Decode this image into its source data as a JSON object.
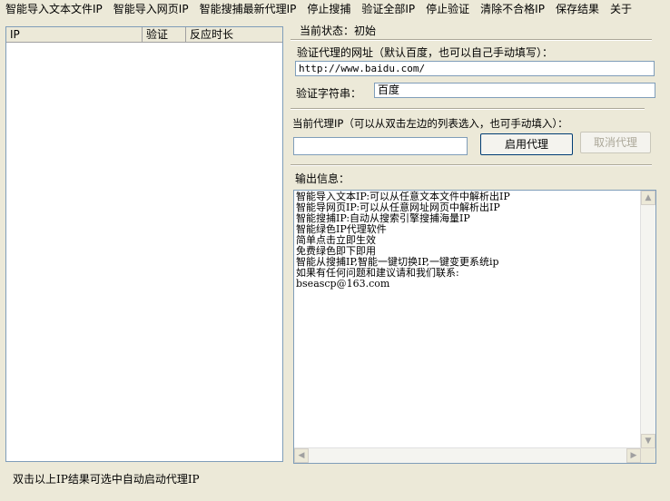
{
  "menu": {
    "items": [
      "智能导入文本文件IP",
      "智能导入网页IP",
      "智能搜捕最新代理IP",
      "停止搜捕",
      "验证全部IP",
      "停止验证",
      "清除不合格IP",
      "保存结果",
      "关于"
    ]
  },
  "list": {
    "columns": [
      "IP",
      "验证",
      "反应时长"
    ]
  },
  "status_panel": {
    "current_status": "当前状态：初始",
    "verify_url_label": "验证代理的网址（默认百度，也可以自己手动填写）：",
    "verify_url_value": "http://www.baidu.com/",
    "verify_string_label": "验证字符串：",
    "verify_string_value": "百度"
  },
  "proxy_panel": {
    "label": "当前代理IP（可以从双击左边的列表选入，也可手动填入）：",
    "proxy_value": "",
    "enable_button": "启用代理",
    "cancel_button": "取消代理"
  },
  "output": {
    "label": "输出信息：",
    "lines": [
      "智能导入文本IP:可以从任意文本文件中解析出IP",
      "智能导网页IP:可以从任意网址网页中解析出IP",
      "智能搜捕IP:自动从搜索引擎搜捕海量IP",
      "智能绿色IP代理软件",
      "简单点击立即生效",
      "免费绿色即下即用",
      "智能从搜捕IP,智能一键切换IP,一键变更系统ip",
      "如果有任何问题和建议请和我们联系:",
      "bseascp@163.com"
    ]
  },
  "statusbar": {
    "hint": "双击以上IP结果可选中自动启动代理IP"
  }
}
